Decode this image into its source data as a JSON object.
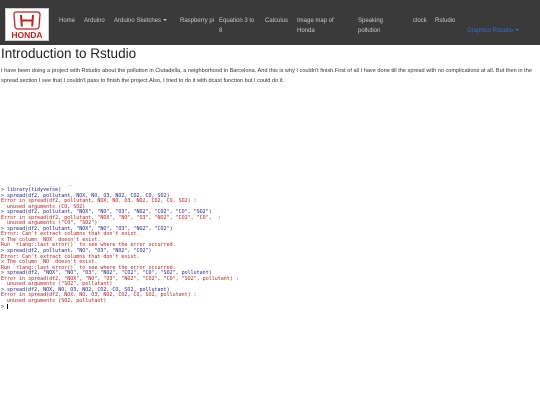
{
  "header": {
    "logo": {
      "brand": "HONDA",
      "icon": "honda-h-logo"
    },
    "nav": [
      {
        "label": "Home"
      },
      {
        "label": "Arduino"
      },
      {
        "label": "Arduino Sketches"
      },
      {
        "label": "Raspberry pi"
      },
      {
        "label": "Equation 3 to 8"
      },
      {
        "label": "Calculus"
      },
      {
        "label": "Image map of Honda"
      },
      {
        "label": "Speaking pollution"
      },
      {
        "label": "clock"
      },
      {
        "label": "Rstudio"
      },
      {
        "label": "Graphics Rstudio"
      }
    ],
    "colors": {
      "bar": "#3a3a3a",
      "link": "#c8c8c8",
      "active": "#2f6fd8",
      "logo_red": "#cc1f1f"
    }
  },
  "main": {
    "title": "Introduction to Rstudio",
    "intro": "I have been doing a project with Rstudio about the pollution in Ciutadella, a neighborhood in Barcelona. And this is why I couldn't finish.First of all I have done till the spread with no complications at all. But then in the spread section I see that I couldn't pass to finish the project.Also, I tried to do it with dcast function but I could do it."
  },
  "console": {
    "colors": {
      "command": "#1a1a96",
      "error": "#c71818"
    },
    "lines": [
      {
        "type": "err",
        "text": "Run `rlang::last_error()` to see where the error occurred."
      },
      {
        "type": "cmd",
        "text": "> library(tidyverse)"
      },
      {
        "type": "cmd",
        "text": "> spread(df2, pollutant, NOX, NO, O3, NO2, CO2, CO, SO2)"
      },
      {
        "type": "err",
        "text": "Error in spread(df2, pollutant, NOX, NO, O3, NO2, CO2, CO, SO2) :"
      },
      {
        "type": "err",
        "text": "  unused arguments (CO, SO2)"
      },
      {
        "type": "cmd",
        "text": "> spread(df2, pollutant, \"NOX\", \"NO\", \"O3\", \"NO2\", \"CO2\", \"CO\", \"SO2\")"
      },
      {
        "type": "err",
        "text": "Error in spread(df2, pollutant, \"NOX\", \"NO\", \"O3\", \"NO2\", \"CO2\", \"CO\",  :"
      },
      {
        "type": "err",
        "text": "  unused arguments (\"CO\", \"SO2\")"
      },
      {
        "type": "cmd",
        "text": "> spread(df2, pollutant, \"NOX\", \"NO\", \"O3\", \"NO2\", \"CO2\")"
      },
      {
        "type": "err",
        "text": "Error: Can't extract columns that don't exist."
      },
      {
        "type": "err",
        "text": "x The column `NOX` doesn't exist."
      },
      {
        "type": "err",
        "text": "Run `rlang::last_error()` to see where the error occurred."
      },
      {
        "type": "cmd",
        "text": "> spread(df2, pollutant, \"NO\", \"O3\", \"NO2\", \"CO2\")"
      },
      {
        "type": "err",
        "text": "Error: Can't extract columns that don't exist."
      },
      {
        "type": "err",
        "text": "x The column `NO` doesn't exist."
      },
      {
        "type": "err",
        "text": "Run `rlang::last_error()` to see where the error occurred."
      },
      {
        "type": "cmd",
        "text": "> spread(df2, \"NOX\", \"NO\", \"O3\", \"NO2\", \"CO2\", \"CO\", \"SO2\", pollutant)"
      },
      {
        "type": "err",
        "text": "Error in spread(df2, \"NOX\", \"NO\", \"O3\", \"NO2\", \"CO2\", \"CO\", \"SO2\", pollutant) :"
      },
      {
        "type": "err",
        "text": "  unused arguments (\"SO2\", pollutant)"
      },
      {
        "type": "cmd",
        "text": "> spread(df2, NOX, NO, O3, NO2, CO2, CO, SO2, pollutant)"
      },
      {
        "type": "err",
        "text": "Error in spread(df2, NOX, NO, O3, NO2, CO2, CO, SO2, pollutant) :"
      },
      {
        "type": "err",
        "text": "  unused arguments (SO2, pollutant)"
      }
    ],
    "prompt": ">"
  }
}
